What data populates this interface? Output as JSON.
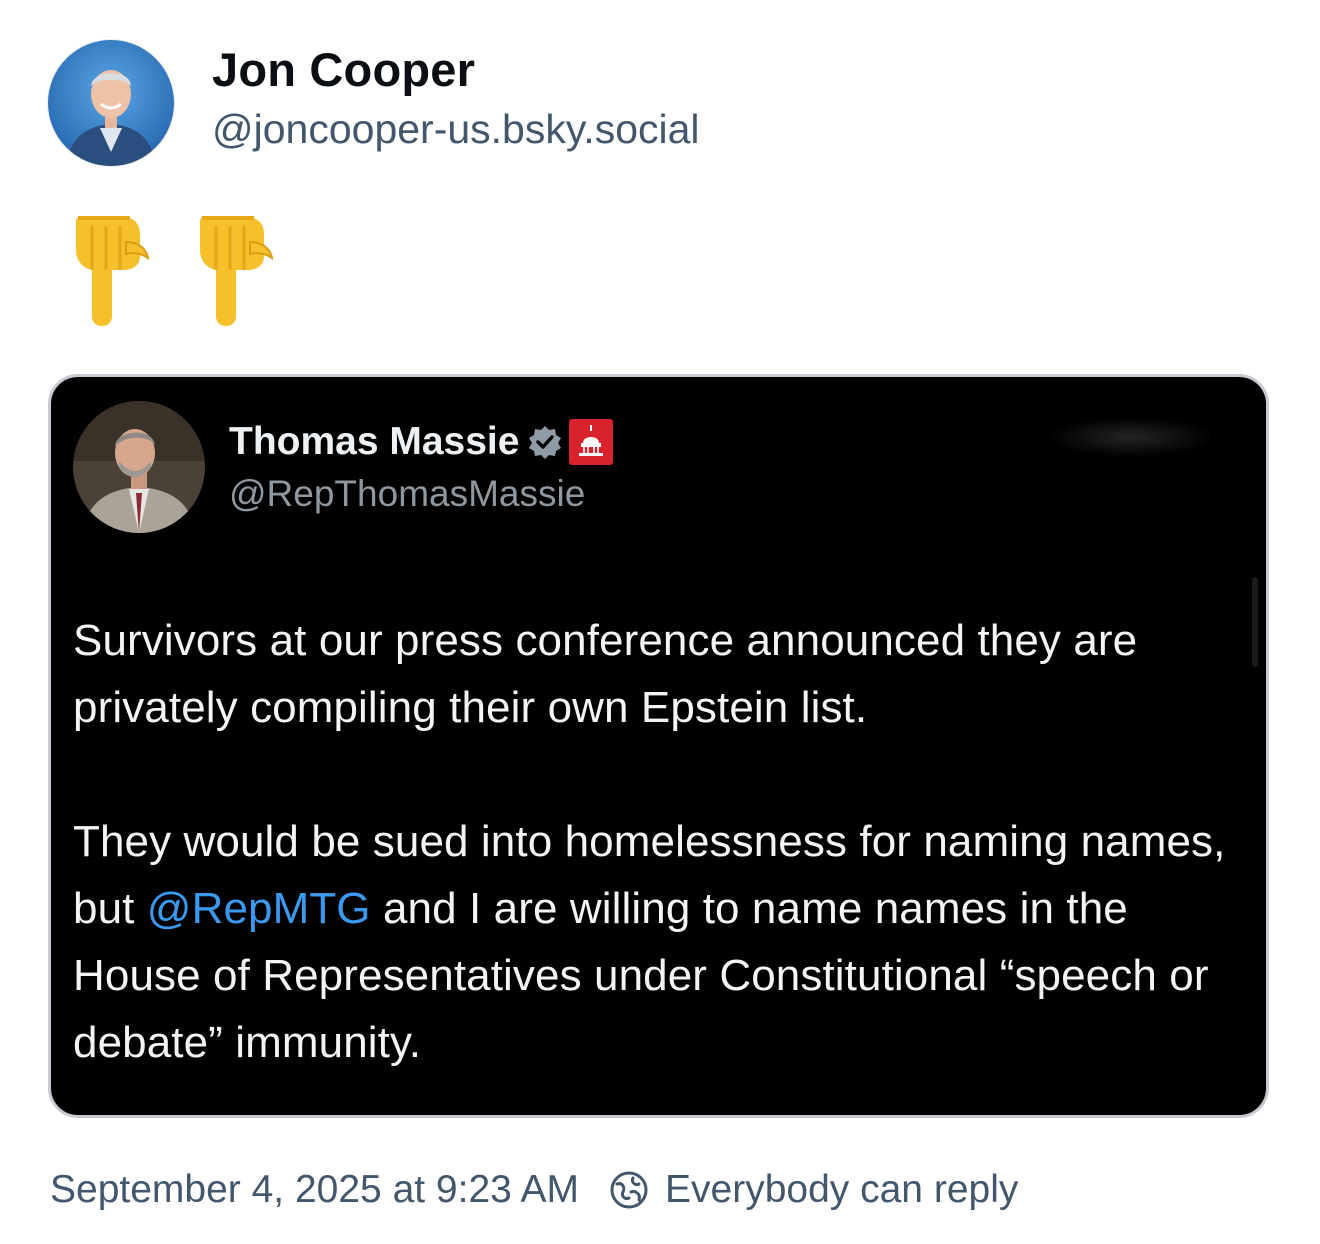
{
  "author": {
    "display_name": "Jon Cooper",
    "handle": "@joncooper-us.bsky.social",
    "avatar_icon": "avatar"
  },
  "post": {
    "text_emojis": [
      "👇",
      "👇"
    ]
  },
  "embed": {
    "display_name": "Thomas Massie",
    "handle": "@RepThomasMassie",
    "verified_icon": "verified-badge-icon",
    "affiliation_icon": "capitol-badge-icon",
    "paragraphs": {
      "p1": "Survivors at our press conference announced they are privately compiling their own Epstein list.",
      "p2_before": "They would be sued into homelessness for naming names, but ",
      "p2_mention": "@RepMTG",
      "p2_after": " and I are willing to name names in the House of Representatives under Constitutional “speech or debate” immunity."
    }
  },
  "footer": {
    "timestamp": "September 4, 2025 at 9:23 AM",
    "reply_setting": "Everybody can reply"
  },
  "colors": {
    "mention": "#3a9af2",
    "secondary_text": "#42576c",
    "embed_background": "#000000",
    "gov_badge": "#d8232f"
  }
}
